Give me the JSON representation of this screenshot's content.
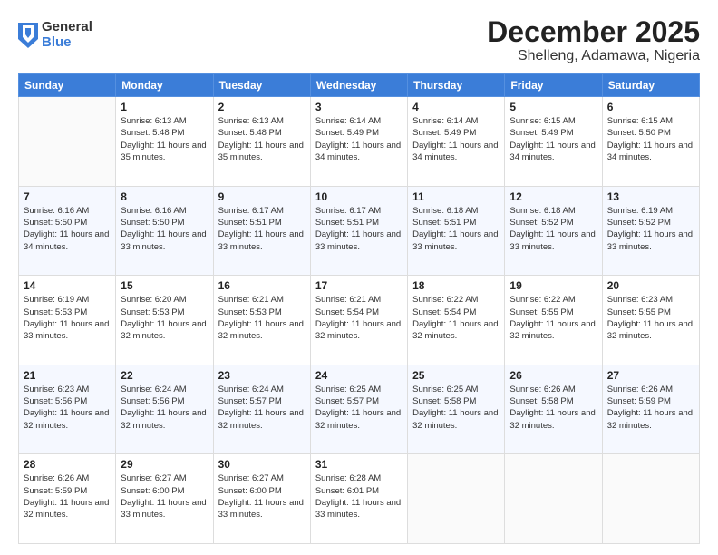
{
  "logo": {
    "general": "General",
    "blue": "Blue"
  },
  "header": {
    "month": "December 2025",
    "location": "Shelleng, Adamawa, Nigeria"
  },
  "days_of_week": [
    "Sunday",
    "Monday",
    "Tuesday",
    "Wednesday",
    "Thursday",
    "Friday",
    "Saturday"
  ],
  "weeks": [
    [
      {
        "day": "",
        "sunrise": "",
        "sunset": "",
        "daylight": ""
      },
      {
        "day": "1",
        "sunrise": "Sunrise: 6:13 AM",
        "sunset": "Sunset: 5:48 PM",
        "daylight": "Daylight: 11 hours and 35 minutes."
      },
      {
        "day": "2",
        "sunrise": "Sunrise: 6:13 AM",
        "sunset": "Sunset: 5:48 PM",
        "daylight": "Daylight: 11 hours and 35 minutes."
      },
      {
        "day": "3",
        "sunrise": "Sunrise: 6:14 AM",
        "sunset": "Sunset: 5:49 PM",
        "daylight": "Daylight: 11 hours and 34 minutes."
      },
      {
        "day": "4",
        "sunrise": "Sunrise: 6:14 AM",
        "sunset": "Sunset: 5:49 PM",
        "daylight": "Daylight: 11 hours and 34 minutes."
      },
      {
        "day": "5",
        "sunrise": "Sunrise: 6:15 AM",
        "sunset": "Sunset: 5:49 PM",
        "daylight": "Daylight: 11 hours and 34 minutes."
      },
      {
        "day": "6",
        "sunrise": "Sunrise: 6:15 AM",
        "sunset": "Sunset: 5:50 PM",
        "daylight": "Daylight: 11 hours and 34 minutes."
      }
    ],
    [
      {
        "day": "7",
        "sunrise": "Sunrise: 6:16 AM",
        "sunset": "Sunset: 5:50 PM",
        "daylight": "Daylight: 11 hours and 34 minutes."
      },
      {
        "day": "8",
        "sunrise": "Sunrise: 6:16 AM",
        "sunset": "Sunset: 5:50 PM",
        "daylight": "Daylight: 11 hours and 33 minutes."
      },
      {
        "day": "9",
        "sunrise": "Sunrise: 6:17 AM",
        "sunset": "Sunset: 5:51 PM",
        "daylight": "Daylight: 11 hours and 33 minutes."
      },
      {
        "day": "10",
        "sunrise": "Sunrise: 6:17 AM",
        "sunset": "Sunset: 5:51 PM",
        "daylight": "Daylight: 11 hours and 33 minutes."
      },
      {
        "day": "11",
        "sunrise": "Sunrise: 6:18 AM",
        "sunset": "Sunset: 5:51 PM",
        "daylight": "Daylight: 11 hours and 33 minutes."
      },
      {
        "day": "12",
        "sunrise": "Sunrise: 6:18 AM",
        "sunset": "Sunset: 5:52 PM",
        "daylight": "Daylight: 11 hours and 33 minutes."
      },
      {
        "day": "13",
        "sunrise": "Sunrise: 6:19 AM",
        "sunset": "Sunset: 5:52 PM",
        "daylight": "Daylight: 11 hours and 33 minutes."
      }
    ],
    [
      {
        "day": "14",
        "sunrise": "Sunrise: 6:19 AM",
        "sunset": "Sunset: 5:53 PM",
        "daylight": "Daylight: 11 hours and 33 minutes."
      },
      {
        "day": "15",
        "sunrise": "Sunrise: 6:20 AM",
        "sunset": "Sunset: 5:53 PM",
        "daylight": "Daylight: 11 hours and 32 minutes."
      },
      {
        "day": "16",
        "sunrise": "Sunrise: 6:21 AM",
        "sunset": "Sunset: 5:53 PM",
        "daylight": "Daylight: 11 hours and 32 minutes."
      },
      {
        "day": "17",
        "sunrise": "Sunrise: 6:21 AM",
        "sunset": "Sunset: 5:54 PM",
        "daylight": "Daylight: 11 hours and 32 minutes."
      },
      {
        "day": "18",
        "sunrise": "Sunrise: 6:22 AM",
        "sunset": "Sunset: 5:54 PM",
        "daylight": "Daylight: 11 hours and 32 minutes."
      },
      {
        "day": "19",
        "sunrise": "Sunrise: 6:22 AM",
        "sunset": "Sunset: 5:55 PM",
        "daylight": "Daylight: 11 hours and 32 minutes."
      },
      {
        "day": "20",
        "sunrise": "Sunrise: 6:23 AM",
        "sunset": "Sunset: 5:55 PM",
        "daylight": "Daylight: 11 hours and 32 minutes."
      }
    ],
    [
      {
        "day": "21",
        "sunrise": "Sunrise: 6:23 AM",
        "sunset": "Sunset: 5:56 PM",
        "daylight": "Daylight: 11 hours and 32 minutes."
      },
      {
        "day": "22",
        "sunrise": "Sunrise: 6:24 AM",
        "sunset": "Sunset: 5:56 PM",
        "daylight": "Daylight: 11 hours and 32 minutes."
      },
      {
        "day": "23",
        "sunrise": "Sunrise: 6:24 AM",
        "sunset": "Sunset: 5:57 PM",
        "daylight": "Daylight: 11 hours and 32 minutes."
      },
      {
        "day": "24",
        "sunrise": "Sunrise: 6:25 AM",
        "sunset": "Sunset: 5:57 PM",
        "daylight": "Daylight: 11 hours and 32 minutes."
      },
      {
        "day": "25",
        "sunrise": "Sunrise: 6:25 AM",
        "sunset": "Sunset: 5:58 PM",
        "daylight": "Daylight: 11 hours and 32 minutes."
      },
      {
        "day": "26",
        "sunrise": "Sunrise: 6:26 AM",
        "sunset": "Sunset: 5:58 PM",
        "daylight": "Daylight: 11 hours and 32 minutes."
      },
      {
        "day": "27",
        "sunrise": "Sunrise: 6:26 AM",
        "sunset": "Sunset: 5:59 PM",
        "daylight": "Daylight: 11 hours and 32 minutes."
      }
    ],
    [
      {
        "day": "28",
        "sunrise": "Sunrise: 6:26 AM",
        "sunset": "Sunset: 5:59 PM",
        "daylight": "Daylight: 11 hours and 32 minutes."
      },
      {
        "day": "29",
        "sunrise": "Sunrise: 6:27 AM",
        "sunset": "Sunset: 6:00 PM",
        "daylight": "Daylight: 11 hours and 33 minutes."
      },
      {
        "day": "30",
        "sunrise": "Sunrise: 6:27 AM",
        "sunset": "Sunset: 6:00 PM",
        "daylight": "Daylight: 11 hours and 33 minutes."
      },
      {
        "day": "31",
        "sunrise": "Sunrise: 6:28 AM",
        "sunset": "Sunset: 6:01 PM",
        "daylight": "Daylight: 11 hours and 33 minutes."
      },
      {
        "day": "",
        "sunrise": "",
        "sunset": "",
        "daylight": ""
      },
      {
        "day": "",
        "sunrise": "",
        "sunset": "",
        "daylight": ""
      },
      {
        "day": "",
        "sunrise": "",
        "sunset": "",
        "daylight": ""
      }
    ]
  ]
}
